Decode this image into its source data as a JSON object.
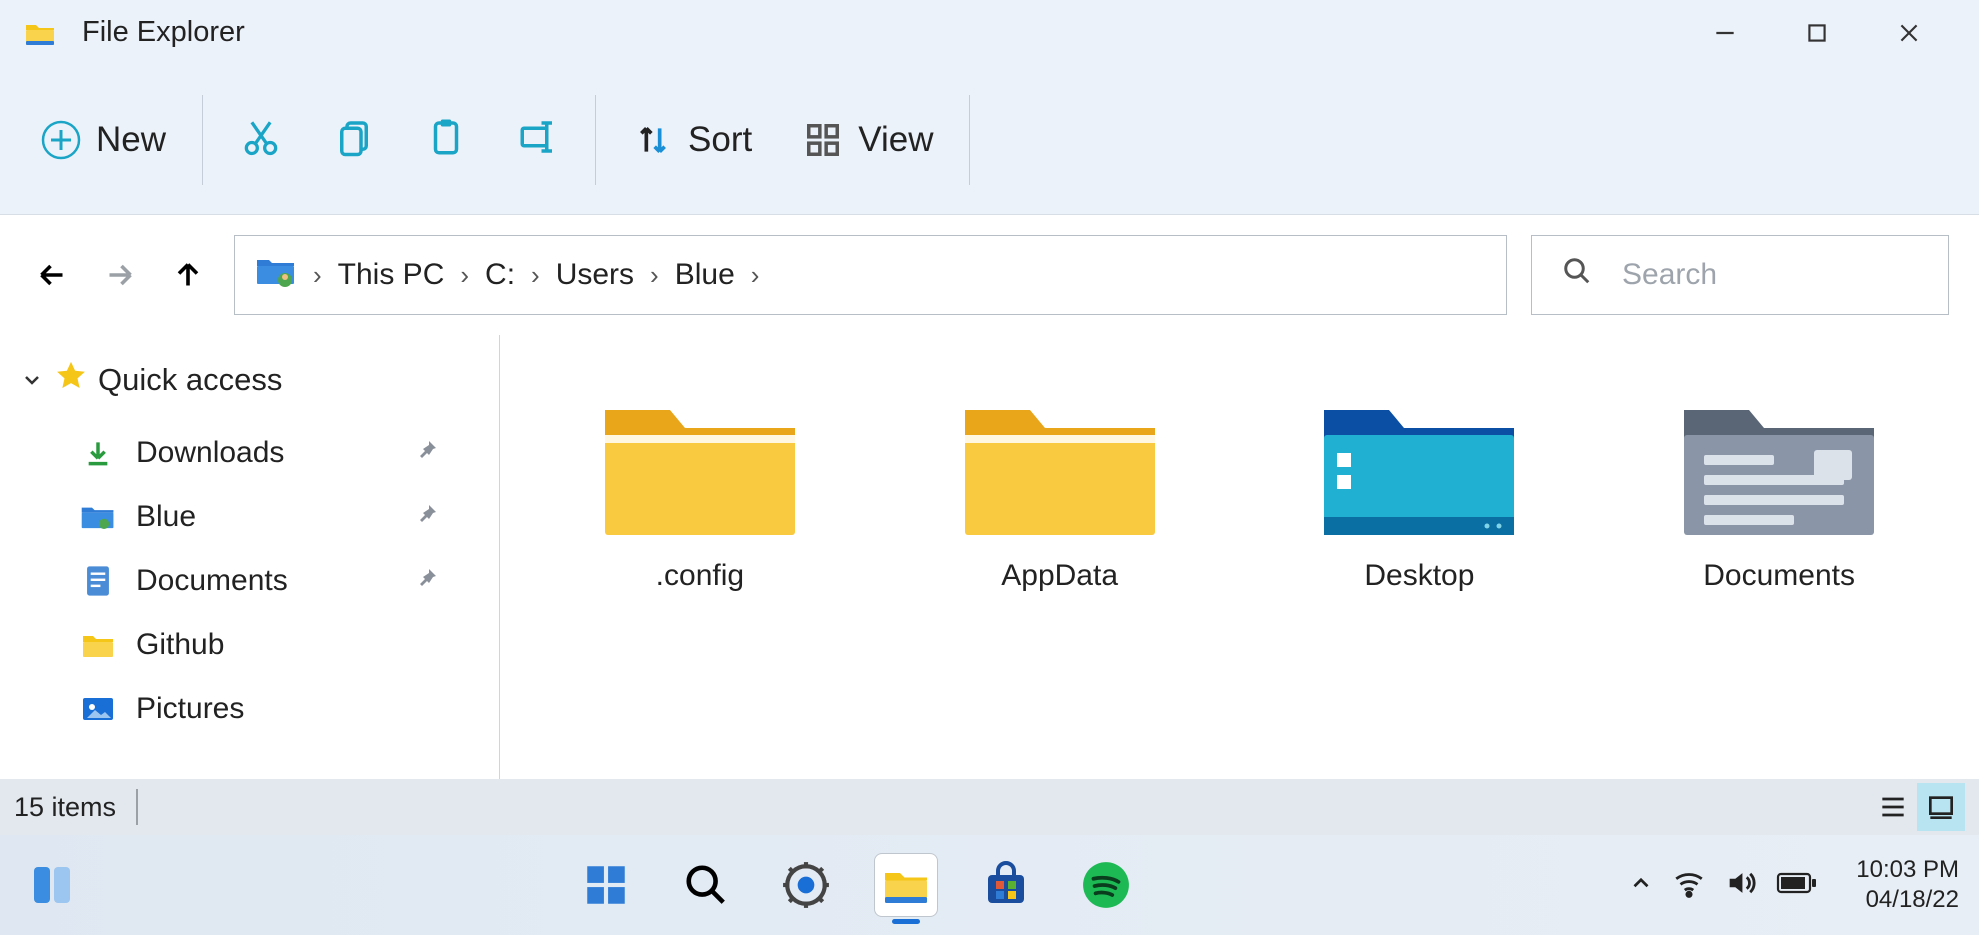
{
  "window": {
    "title": "File Explorer"
  },
  "toolbar": {
    "new_label": "New",
    "sort_label": "Sort",
    "view_label": "View"
  },
  "breadcrumb": {
    "items": [
      "This PC",
      "C:",
      "Users",
      "Blue"
    ]
  },
  "search": {
    "placeholder": "Search"
  },
  "sidebar": {
    "header": "Quick access",
    "items": [
      {
        "label": "Downloads",
        "icon": "download",
        "pinned": true
      },
      {
        "label": "Blue",
        "icon": "userfolder",
        "pinned": true
      },
      {
        "label": "Documents",
        "icon": "documents",
        "pinned": true
      },
      {
        "label": "Github",
        "icon": "folder",
        "pinned": false
      },
      {
        "label": "Pictures",
        "icon": "pictures",
        "pinned": false
      }
    ]
  },
  "files": [
    {
      "label": ".config",
      "kind": "folder-yellow"
    },
    {
      "label": "AppData",
      "kind": "folder-yellow"
    },
    {
      "label": "Desktop",
      "kind": "folder-desktop"
    },
    {
      "label": "Documents",
      "kind": "folder-documents"
    }
  ],
  "statusbar": {
    "count_text": "15 items"
  },
  "taskbar": {
    "time": "10:03 PM",
    "date": "04/18/22"
  }
}
